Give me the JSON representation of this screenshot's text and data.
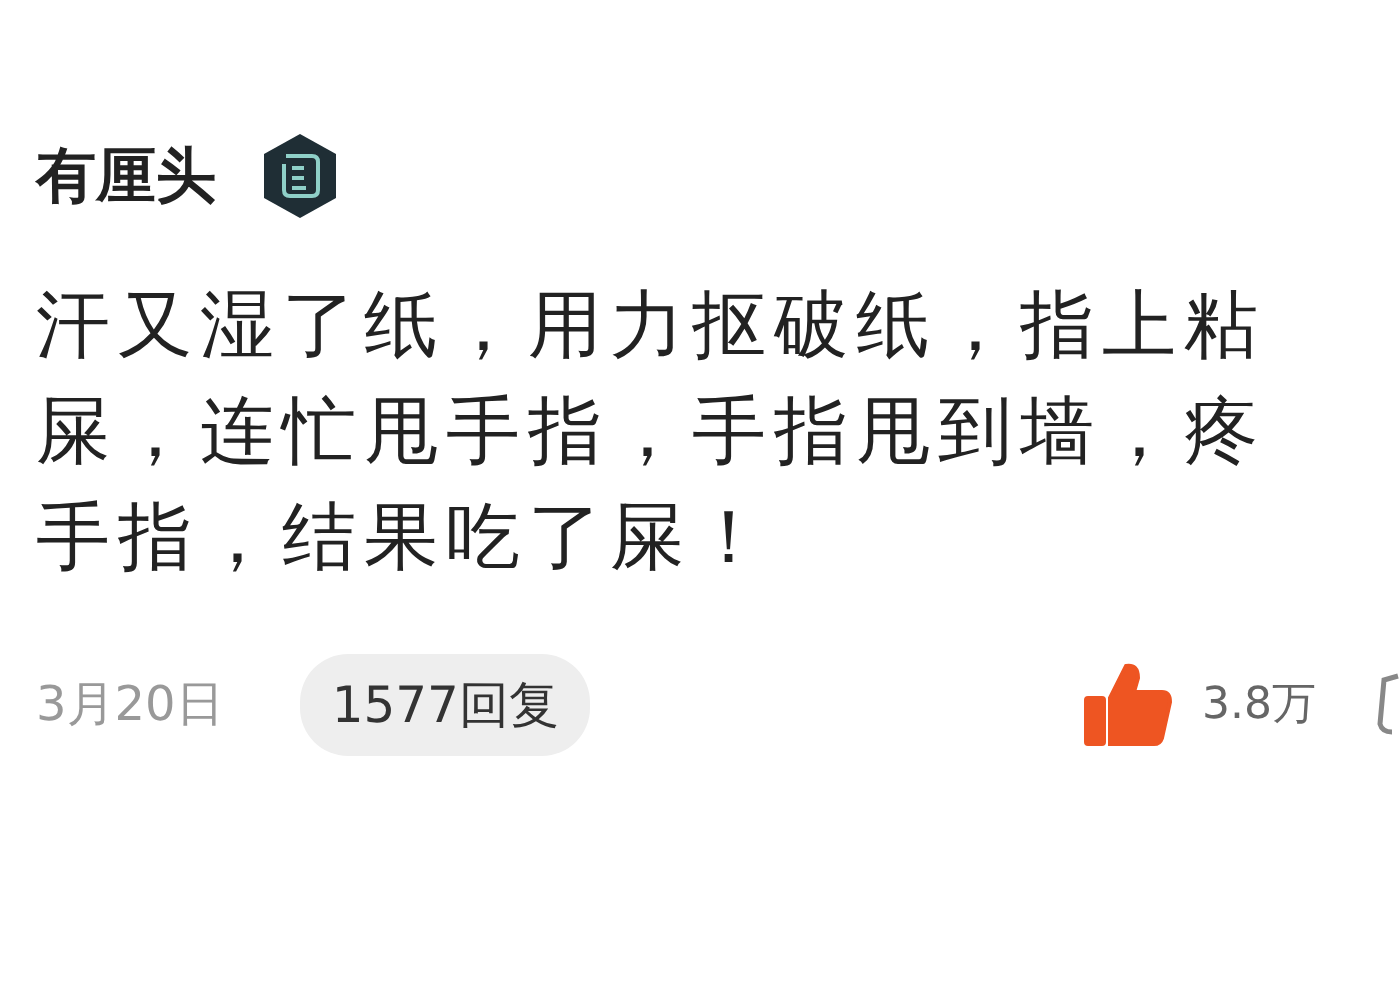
{
  "comment": {
    "author": "有厘头",
    "lines": [
      "汗又湿了纸，用力抠破纸，指上粘",
      "屎，连忙甩手指，手指甩到墙，疼",
      "手指，结果吃了屎！"
    ],
    "date": "3月20日",
    "replies": "1577回复",
    "likes": "3.8万",
    "liked": true
  }
}
